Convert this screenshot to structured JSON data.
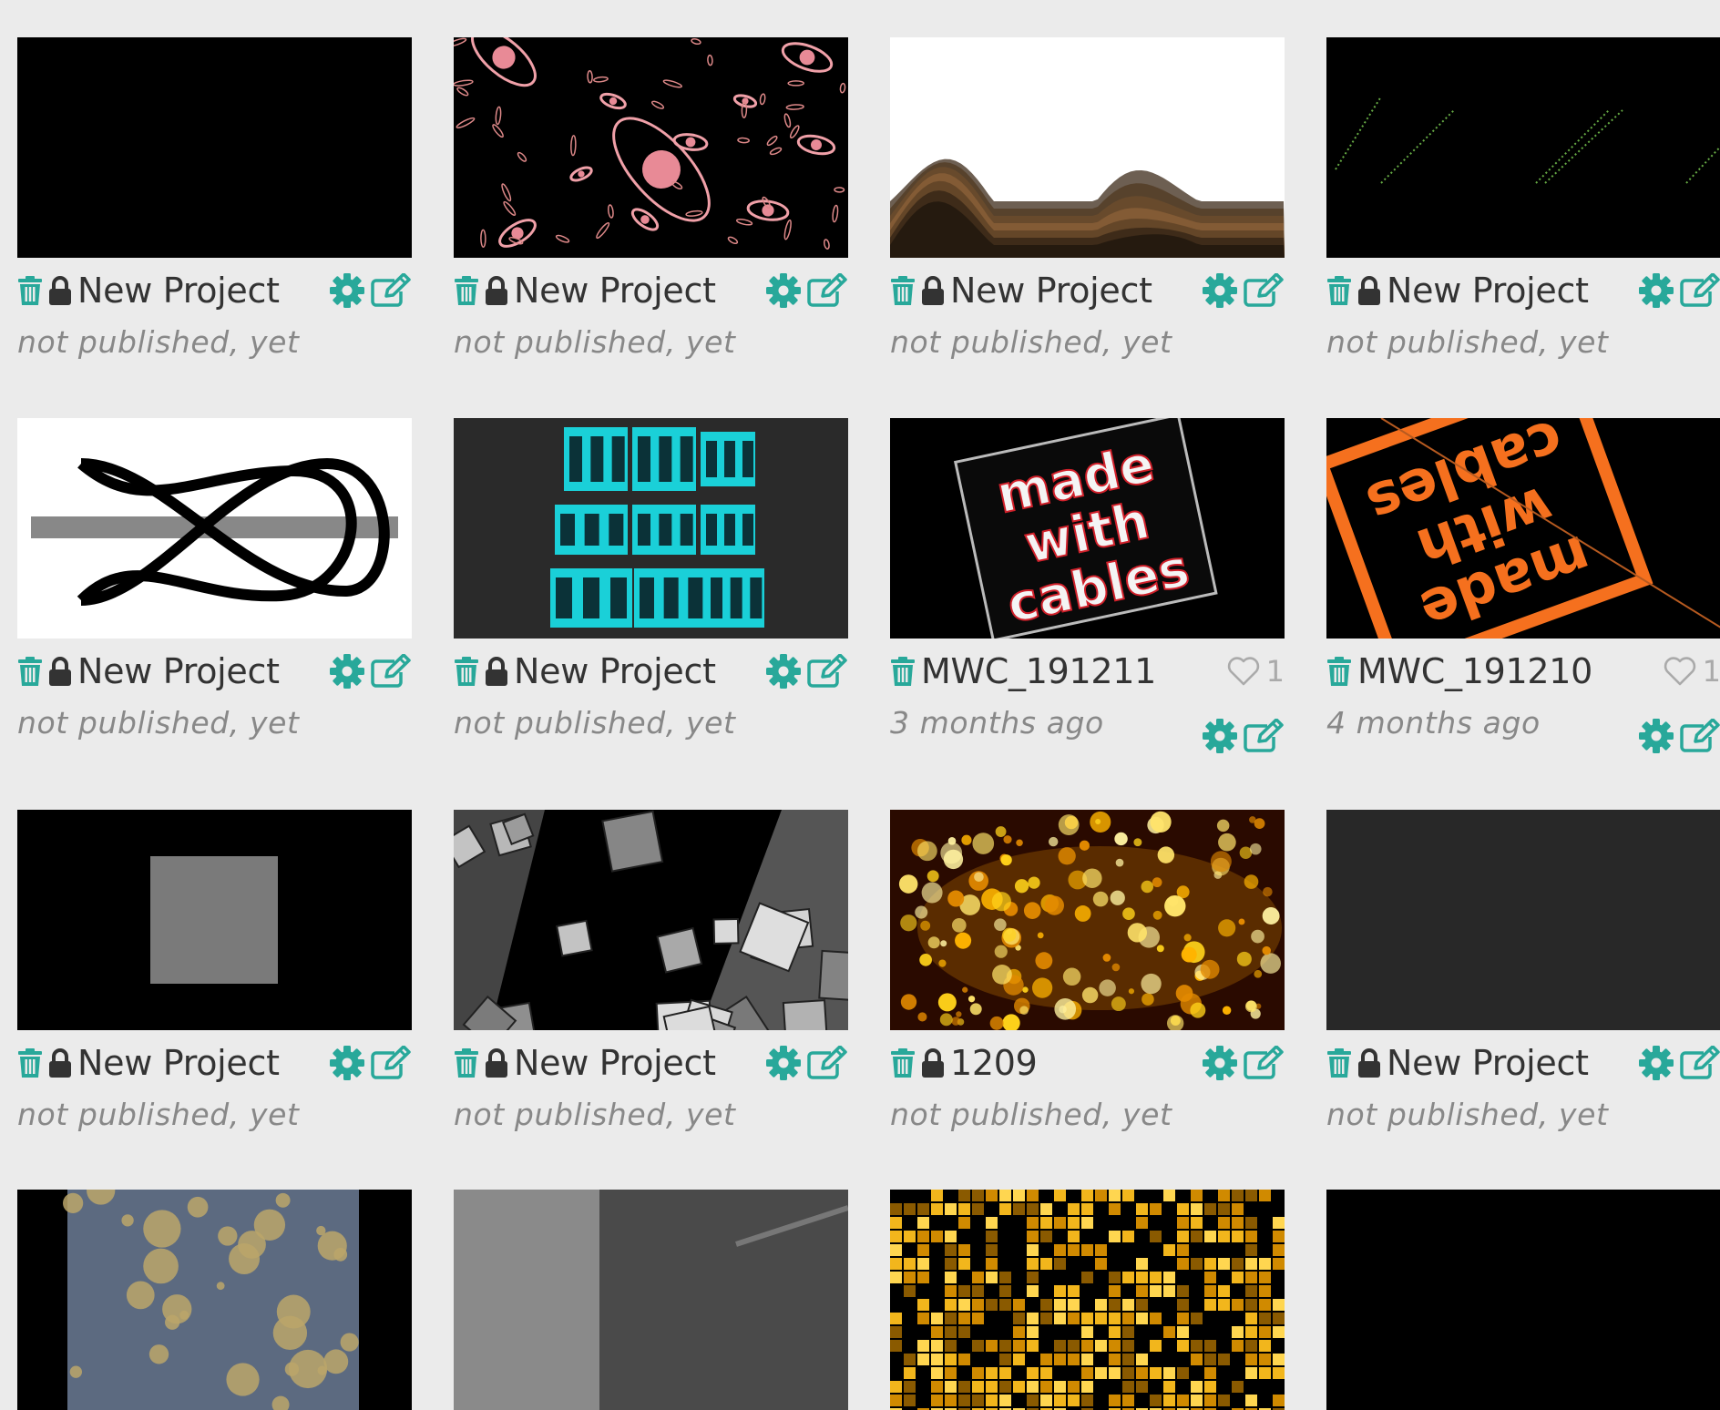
{
  "colors": {
    "accent": "#28a89a",
    "text": "#333333",
    "muted": "#888888",
    "background": "#ebebeb"
  },
  "icons": {
    "delete": "trash-icon",
    "private": "lock-icon",
    "settings": "gear-icon",
    "edit": "edit-icon",
    "favorite": "heart-icon"
  },
  "projects": [
    {
      "title": "New Project",
      "subtitle": "not published, yet",
      "locked": true,
      "thumb": "black"
    },
    {
      "title": "New Project",
      "subtitle": "not published, yet",
      "locked": true,
      "thumb": "eyes"
    },
    {
      "title": "New Project",
      "subtitle": "not published, yet",
      "locked": true,
      "thumb": "waves"
    },
    {
      "title": "New Project",
      "subtitle": "not published, yet",
      "locked": true,
      "thumb": "stripes"
    },
    {
      "title": "New Project",
      "subtitle": "not published, yet",
      "locked": true,
      "thumb": "fish"
    },
    {
      "title": "New Project",
      "subtitle": "not published, yet",
      "locked": true,
      "thumb": "cubes-cyan"
    },
    {
      "title": "MWC_191211",
      "subtitle": "3 months ago",
      "locked": false,
      "likes": "1",
      "thumb": "mwc-red"
    },
    {
      "title": "MWC_191210",
      "subtitle": "4 months ago",
      "locked": false,
      "likes": "1",
      "thumb": "mwc-orange"
    },
    {
      "title": "New Project",
      "subtitle": "not published, yet",
      "locked": true,
      "thumb": "gray-square"
    },
    {
      "title": "New Project",
      "subtitle": "not published, yet",
      "locked": true,
      "thumb": "gray-cubes"
    },
    {
      "title": "1209",
      "subtitle": "not published, yet",
      "locked": true,
      "thumb": "bokeh"
    },
    {
      "title": "New Project",
      "subtitle": "not published, yet",
      "locked": true,
      "thumb": "dark-gray"
    },
    {
      "thumb": "bubbles"
    },
    {
      "thumb": "gray-planes"
    },
    {
      "thumb": "yellow-tiles"
    },
    {
      "thumb": "black"
    }
  ]
}
